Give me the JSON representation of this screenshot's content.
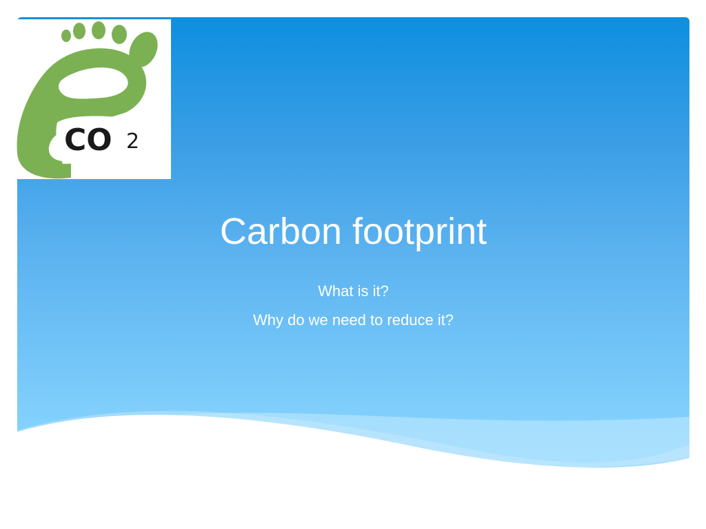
{
  "slide": {
    "title": "Carbon footprint",
    "subtitle_lines": [
      "What is it?",
      "Why do we need to reduce it?"
    ],
    "logo": {
      "icon": "co2-footprint-logo-icon",
      "text_main": "CO",
      "text_sub": "2"
    }
  },
  "colors": {
    "slide_top": "#0d8fe0",
    "slide_bottom": "#8ed7ff",
    "footprint_green": "#7bb153",
    "text": "#ffffff"
  }
}
